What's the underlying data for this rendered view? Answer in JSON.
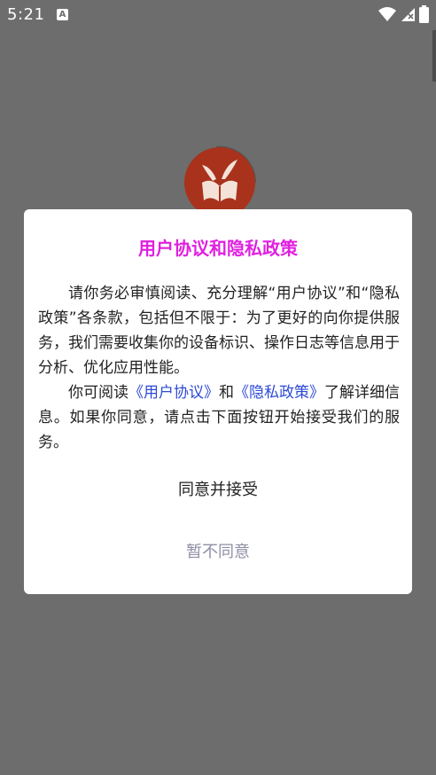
{
  "status_bar": {
    "time": "5:21",
    "app_icon": "A",
    "icons": [
      "wifi-icon",
      "signal-icon",
      "battery-icon"
    ]
  },
  "dialog": {
    "title": "用户协议和隐私政策",
    "p1": "请你务必审慎阅读、充分理解“用户协议”和“隐私政策”各条款，包括但不限于：为了更好的向你提供服务，我们需要收集你的设备标识、操作日志等信息用于分析、优化应用性能。",
    "p2_prefix": "你可阅读",
    "user_agreement_link": "《用户协议》",
    "p2_and": "和",
    "privacy_policy_link": "《隐私政策》",
    "p2_suffix": "了解详细信息。如果你同意，请点击下面按钮开始接受我们的服务。",
    "accept_label": "同意并接受",
    "decline_label": "暂不同意"
  },
  "colors": {
    "title": "#e020e0",
    "link": "#2c4ad6",
    "decline": "#8f8fa6",
    "overlay": "#6d6d6d",
    "logo": "#a8321c"
  }
}
